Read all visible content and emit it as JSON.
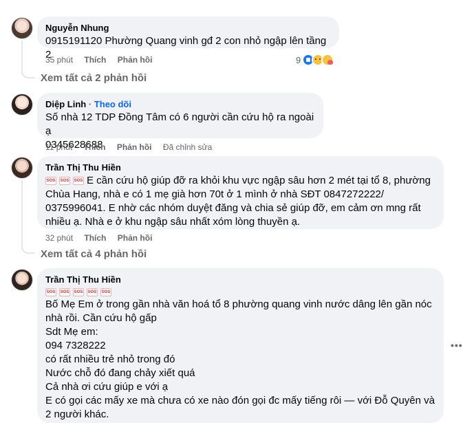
{
  "comments": [
    {
      "author": "Nguyễn Nhung",
      "text": "0915191120 Phường Quang vinh gđ 2 con nhỏ ngập lên tầng 2",
      "time": "35 phút",
      "like_label": "Thích",
      "reply_label": "Phản hồi",
      "reaction_count": "9",
      "view_replies": "Xem tất cả 2 phản hồi"
    },
    {
      "author": "Diệp Linh",
      "follow_label": "Theo dõi",
      "text_lines": [
        "Số nhà 12 TDP Đồng Tâm có 6 người cần cứu hộ ra ngoài ạ",
        "0345628688"
      ],
      "time": "11 phút",
      "like_label": "Thích",
      "reply_label": "Phản hồi",
      "edited_label": "Đã chỉnh sửa"
    },
    {
      "author": "Trần Thị Thu Hiền",
      "sos_label": "SOS",
      "text_first": "E cần cứu hộ giúp đỡ ra khỏi khu vực ngập sâu hơn 2 mét tại tổ 8, phường",
      "text_lines": [
        "Chùa Hang, nhà e có 1 mẹ già hơn 70t ở 1 mình ở nhà SĐT 0847272222/",
        "0375996041. E nhờ các nhóm duyệt đăng và chia sẻ giúp đỡ, em cảm ơn mng rất",
        "nhiều ạ. Nhà e ở khu ngập sâu nhất xóm lòng thuyền ạ."
      ],
      "time": "32 phút",
      "like_label": "Thích",
      "reply_label": "Phản hồi",
      "view_replies": "Xem tất cả 4 phản hồi"
    },
    {
      "author": "Trần Thị Thu Hiền",
      "sos_label": "SOS",
      "text_lines": [
        "Bố Mẹ Em ở trong gần nhà văn hoá tổ 8 phường quang vinh nước dâng lên gần nóc",
        "nhà rồi. Cần cứu hộ gấp",
        "Sdt Mẹ em:",
        "094 7328222",
        "có rất nhiều trẻ nhỏ trong đó",
        "Nước chỗ đó đang chảy xiết quá",
        "Cả nhà ơi cứu giúp e với ạ",
        "E có gọi các mấy xe mà chưa có xe nào đón gọi đc mấy tiếng rôi — với Đỗ Quyên và",
        "2 người khác."
      ],
      "more_icon": "more-horizontal-icon"
    }
  ]
}
